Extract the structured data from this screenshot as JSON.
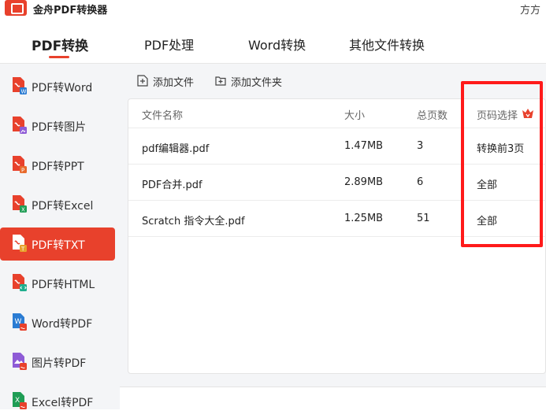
{
  "app": {
    "title": "金舟PDF转换器",
    "user": "方方"
  },
  "topnav": {
    "tabs": [
      {
        "label": "PDF转换"
      },
      {
        "label": "PDF处理"
      },
      {
        "label": "Word转换"
      },
      {
        "label": "其他文件转换"
      }
    ]
  },
  "sidebar": {
    "items": [
      {
        "label": "PDF转Word",
        "icon": "pdf-to-word-icon",
        "badge_color": "#2b7cd3"
      },
      {
        "label": "PDF转图片",
        "icon": "pdf-to-image-icon",
        "badge_color": "#8e5bd6"
      },
      {
        "label": "PDF转PPT",
        "icon": "pdf-to-ppt-icon",
        "badge_color": "#e86a2c"
      },
      {
        "label": "PDF转Excel",
        "icon": "pdf-to-excel-icon",
        "badge_color": "#1f9d55"
      },
      {
        "label": "PDF转TXT",
        "icon": "pdf-to-txt-icon",
        "badge_color": "#e8a02c"
      },
      {
        "label": "PDF转HTML",
        "icon": "pdf-to-html-icon",
        "badge_color": "#1fae8e"
      },
      {
        "label": "Word转PDF",
        "icon": "word-to-pdf-icon",
        "badge_color": "#e8412c"
      },
      {
        "label": "图片转PDF",
        "icon": "image-to-pdf-icon",
        "badge_color": "#e8412c"
      },
      {
        "label": "Excel转PDF",
        "icon": "excel-to-pdf-icon",
        "badge_color": "#e8412c"
      }
    ]
  },
  "toolbar": {
    "add_file": "添加文件",
    "add_folder": "添加文件夹"
  },
  "table": {
    "headers": {
      "name": "文件名称",
      "size": "大小",
      "pages": "总页数",
      "page_select": "页码选择"
    },
    "rows": [
      {
        "name": "pdf编辑器.pdf",
        "size": "1.47MB",
        "pages": "3",
        "page_select": "转换前3页"
      },
      {
        "name": "PDF合并.pdf",
        "size": "2.89MB",
        "pages": "6",
        "page_select": "全部"
      },
      {
        "name": "Scratch 指令大全.pdf",
        "size": "1.25MB",
        "pages": "51",
        "page_select": "全部"
      }
    ]
  },
  "colors": {
    "accent": "#e8412c",
    "highlight": "#ff1a1a",
    "sidebar_bg": "#f4f5f7"
  }
}
